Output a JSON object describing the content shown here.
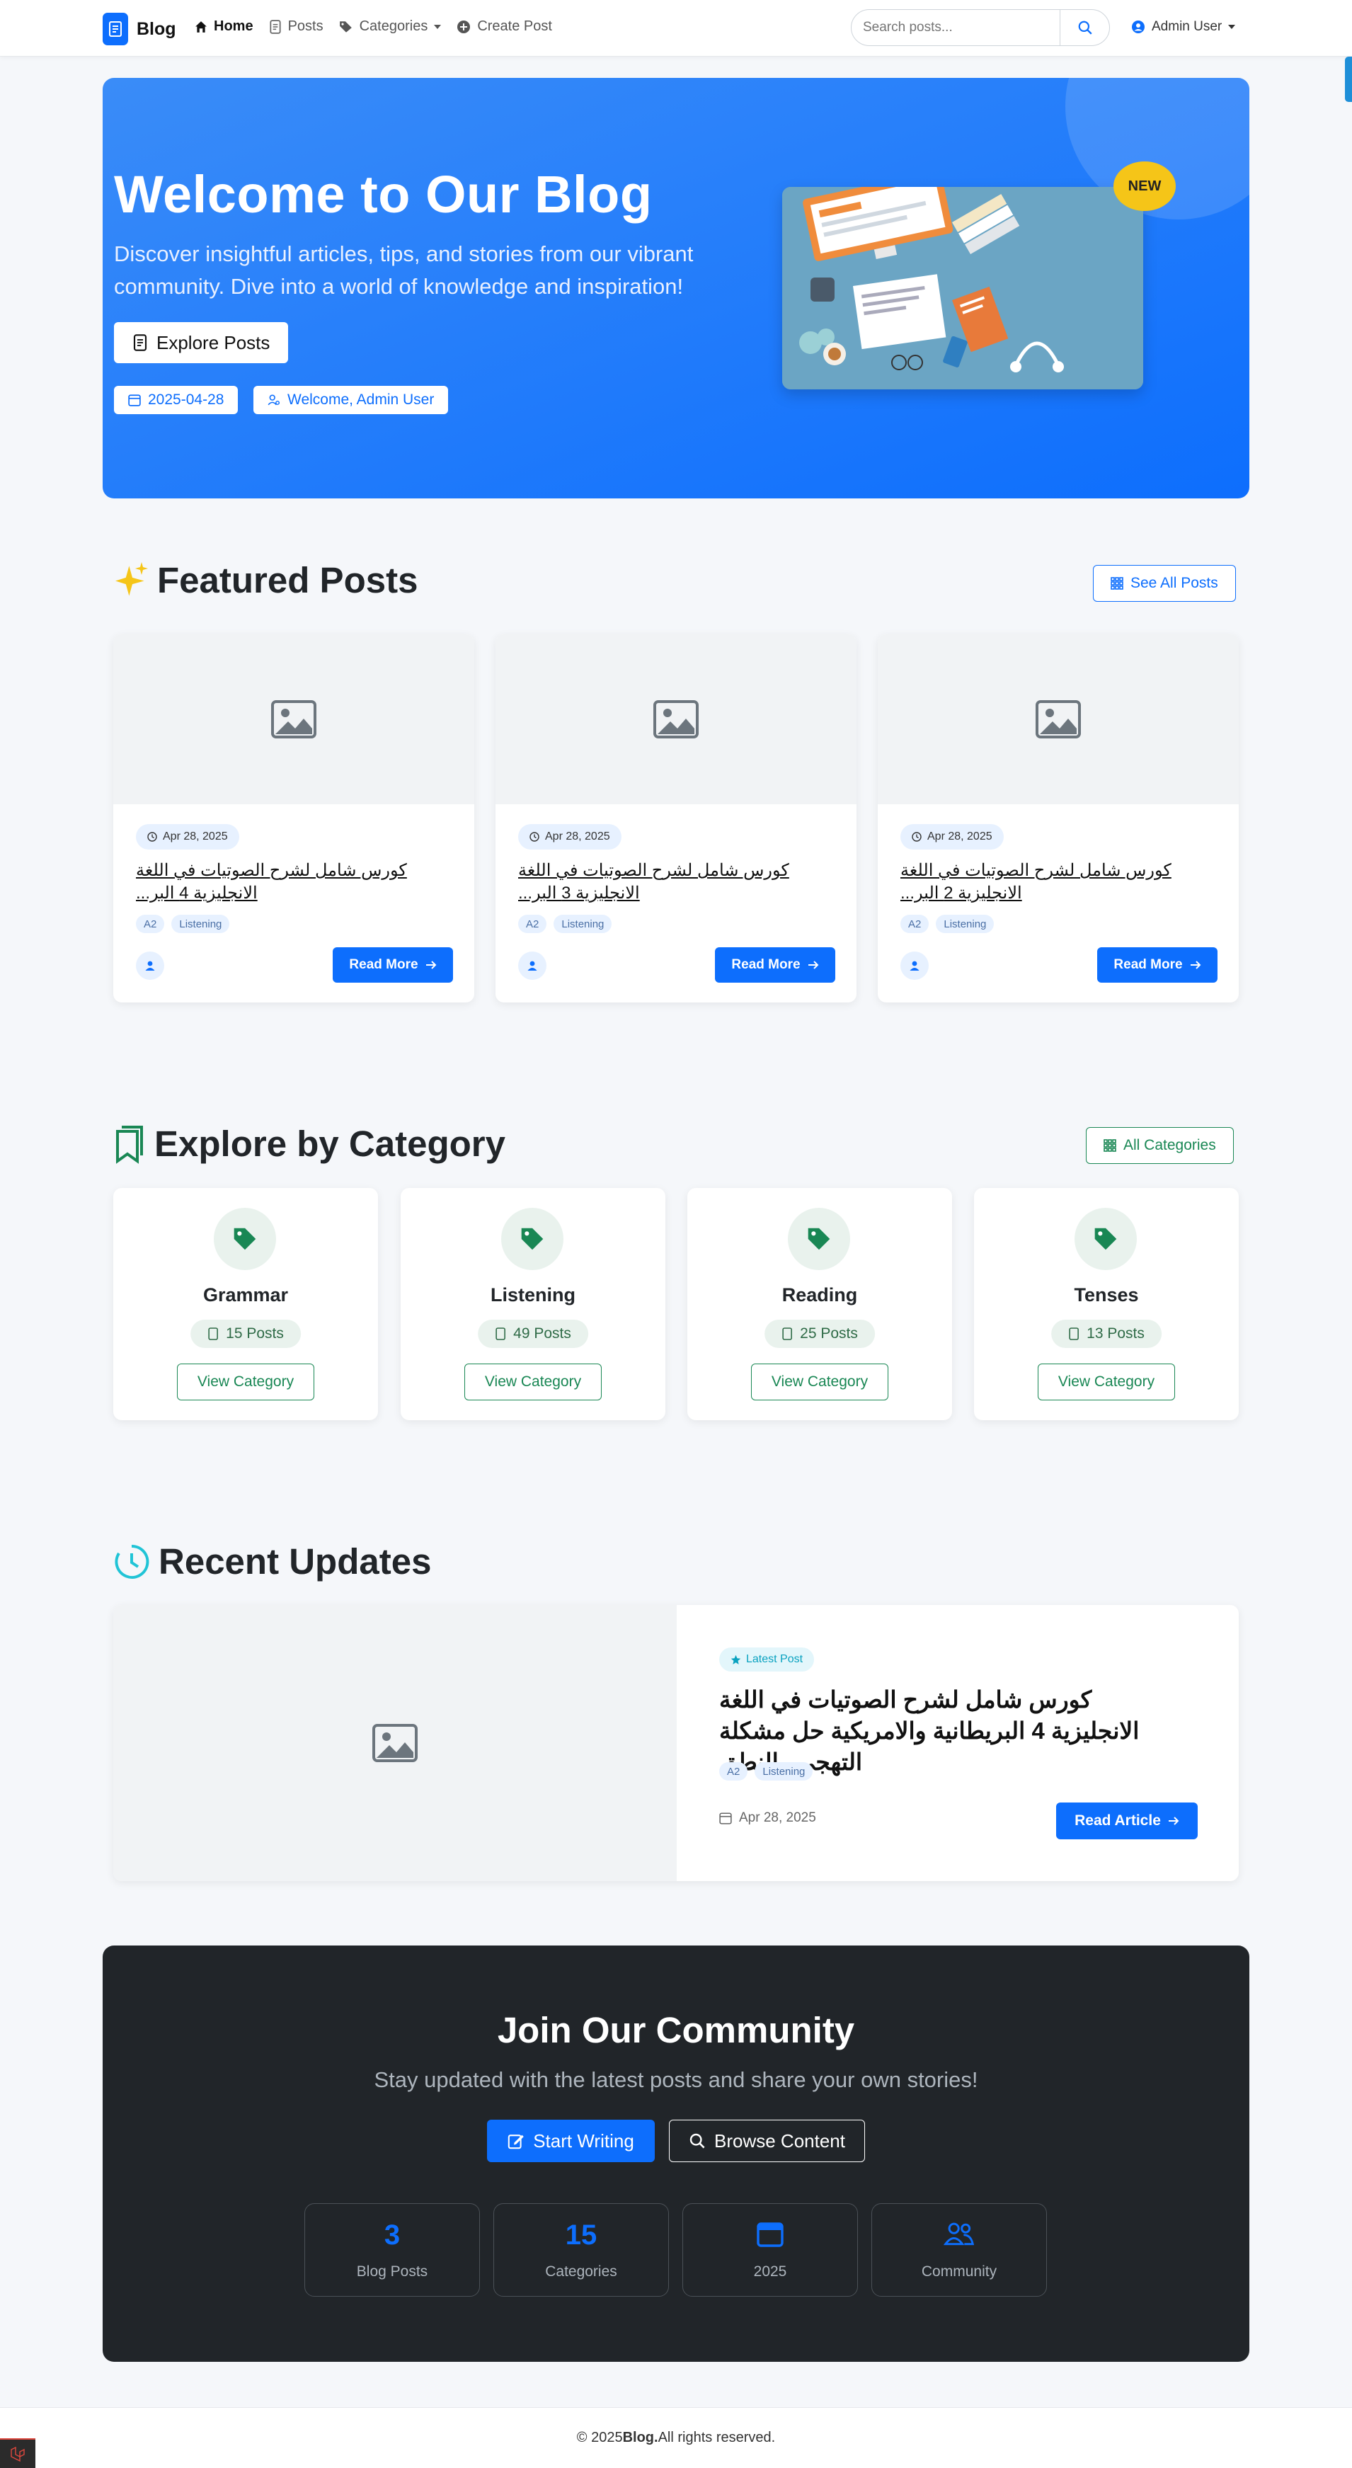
{
  "nav": {
    "brand": "Blog",
    "links": [
      {
        "label": "Home",
        "icon": "house-icon"
      },
      {
        "label": "Posts",
        "icon": "document-icon"
      },
      {
        "label": "Categories",
        "icon": "tags-icon"
      },
      {
        "label": "Create Post",
        "icon": "plus-circle-icon"
      }
    ],
    "search_placeholder": "Search posts...",
    "user": "Admin User"
  },
  "hero": {
    "title": "Welcome to Our Blog",
    "subtitle": "Discover insightful articles, tips, and stories from our vibrant community. Dive into a world of knowledge and inspiration!",
    "button": "Explore Posts",
    "date": "2025-04-28",
    "welcome": "Welcome, Admin User",
    "badge": "NEW",
    "accent": "#0d6efd"
  },
  "featured": {
    "heading": "Featured Posts",
    "see_all": "See All Posts",
    "posts": [
      {
        "date": "Apr 28, 2025",
        "title": "كورس شامل لشرح الصوتيات في اللغة الانجليزية 4 البر...",
        "tags": [
          "A2",
          "Listening"
        ],
        "button": "Read More"
      },
      {
        "date": "Apr 28, 2025",
        "title": "كورس شامل لشرح الصوتيات في اللغة الانجليزية 3 البر...",
        "tags": [
          "A2",
          "Listening"
        ],
        "button": "Read More"
      },
      {
        "date": "Apr 28, 2025",
        "title": "كورس شامل لشرح الصوتيات في اللغة الانجليزية 2 البر...",
        "tags": [
          "A2",
          "Listening"
        ],
        "button": "Read More"
      }
    ]
  },
  "categories": {
    "heading": "Explore by Category",
    "all_button": "All Categories",
    "accent": "#198754",
    "items": [
      {
        "name": "Grammar",
        "count": "15 Posts",
        "button": "View Category"
      },
      {
        "name": "Listening",
        "count": "49 Posts",
        "button": "View Category"
      },
      {
        "name": "Reading",
        "count": "25 Posts",
        "button": "View Category"
      },
      {
        "name": "Tenses",
        "count": "13 Posts",
        "button": "View Category"
      }
    ]
  },
  "recent": {
    "heading": "Recent Updates",
    "badge": "Latest Post",
    "title": "كورس شامل لشرح الصوتيات في اللغة الانجليزية 4 البريطانية والامريكية حل مشكلة التهجي والنطق",
    "tags": [
      "A2",
      "Listening"
    ],
    "date": "Apr 28, 2025",
    "button": "Read Article"
  },
  "community": {
    "title": "Join Our Community",
    "subtitle": "Stay updated with the latest posts and share your own stories!",
    "write_button": "Start Writing",
    "browse_button": "Browse Content",
    "stats": [
      {
        "value": "3",
        "label": "Blog Posts"
      },
      {
        "value": "15",
        "label": "Categories"
      },
      {
        "value": "",
        "label": "2025",
        "icon": "calendar-icon"
      },
      {
        "value": "",
        "label": "Community",
        "icon": "people-icon"
      }
    ]
  },
  "footer": {
    "prefix": "© 2025",
    "brand": "Blog.",
    "suffix": "All rights reserved."
  }
}
